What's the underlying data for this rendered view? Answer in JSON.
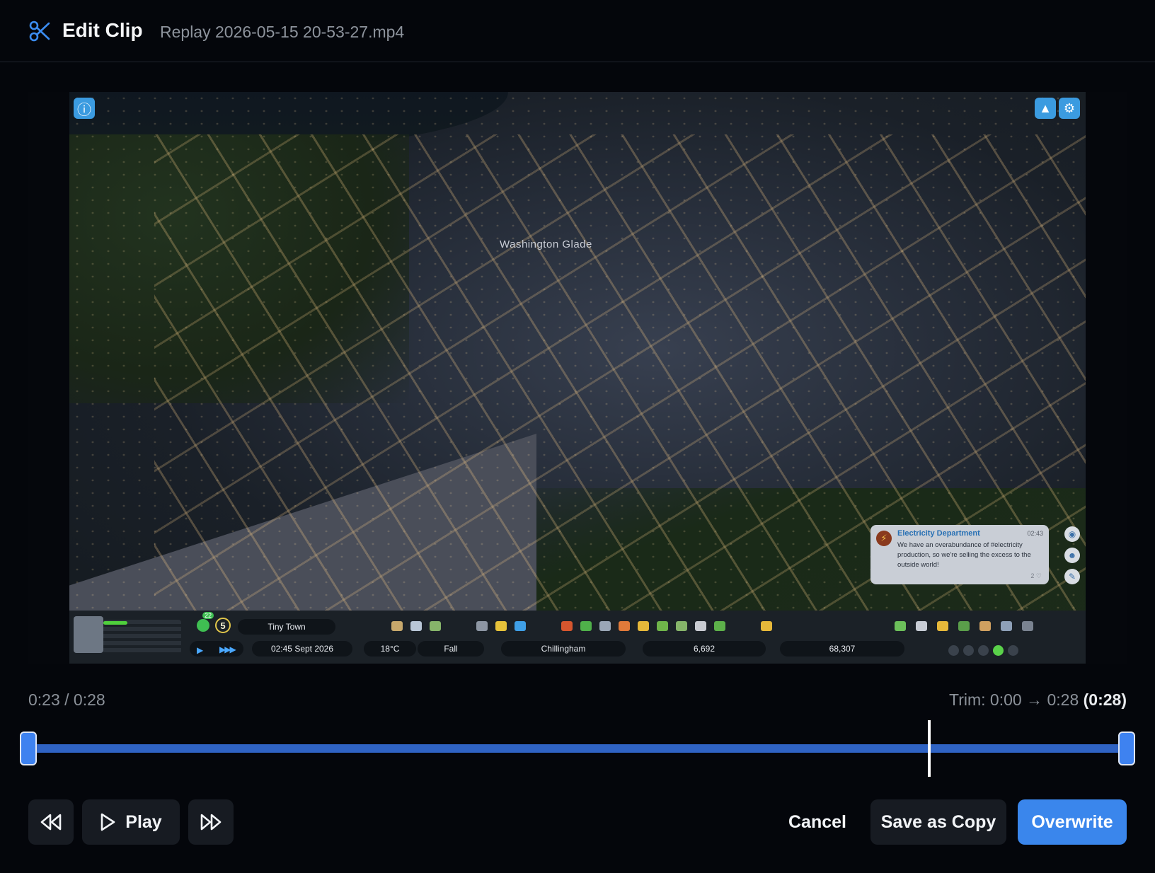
{
  "header": {
    "title": "Edit Clip",
    "filename": "Replay 2026-05-15 20-53-27.mp4"
  },
  "video": {
    "place_label": "Washington Glade",
    "notification": {
      "sender": "Electricity Department",
      "time": "02:43",
      "message": "We have an overabundance of #electricity production, so we're selling the excess to the outside world!",
      "likes": "2 ♡"
    },
    "hud": {
      "xp_badge": "22",
      "level": "5",
      "town_rank": "Tiny Town",
      "clock": "02:45  Sept 2026",
      "temperature": "18°C",
      "season": "Fall",
      "city_name": "Chillingham",
      "population": "6,692",
      "money": "68,307"
    }
  },
  "playback": {
    "time_readout": "0:23 / 0:28",
    "current_fraction": 0.82,
    "trim_prefix": "Trim: 0:00 → 0:28",
    "trim_duration": "(0:28)"
  },
  "actions": {
    "play_label": "Play",
    "cancel_label": "Cancel",
    "save_copy_label": "Save as Copy",
    "overwrite_label": "Overwrite"
  },
  "icons": {
    "scissors": "scissors-icon",
    "rewind": "rewind-icon",
    "play": "play-icon",
    "fast_forward": "fast-forward-icon"
  },
  "colors": {
    "accent": "#3a86ec",
    "track": "#2f63c4",
    "background": "#04060b"
  }
}
